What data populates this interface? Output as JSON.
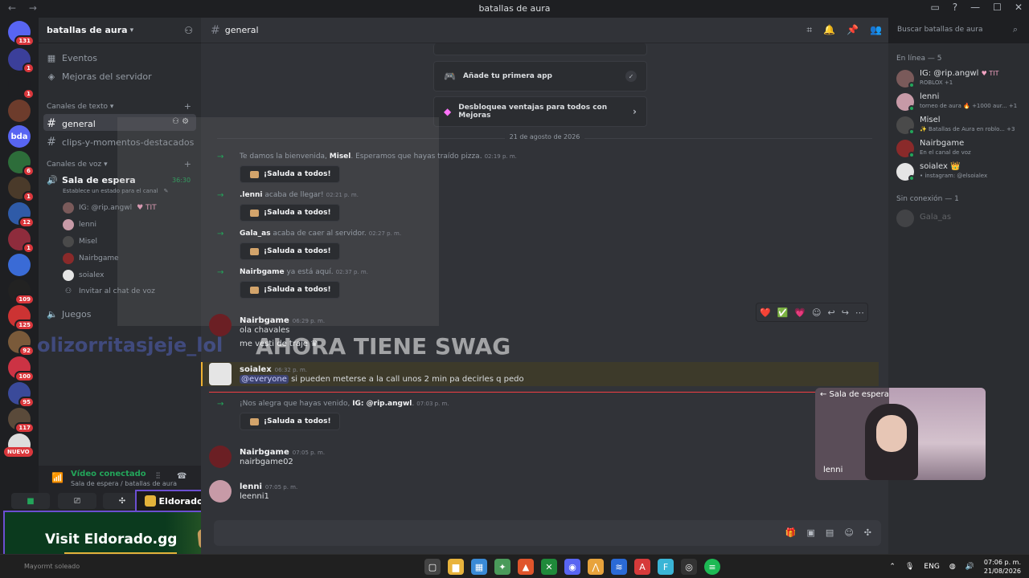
{
  "window": {
    "title": "batallas de aura",
    "nav": "← →",
    "controls": [
      "▭",
      "?",
      "—",
      "☐",
      "✕"
    ]
  },
  "rail": {
    "servers": [
      {
        "label": "",
        "badge": "131",
        "color": "#5865f2"
      },
      {
        "label": "",
        "badge": "1",
        "color": "#3b3f9a"
      },
      {
        "label": "",
        "badge": "1",
        "color": "#1e1f22"
      },
      {
        "label": "",
        "badge": "",
        "color": "#6d3c2c"
      },
      {
        "label": "bda",
        "badge": "",
        "color": "#5865f2"
      },
      {
        "label": "",
        "badge": "6",
        "color": "#2d6d3a"
      },
      {
        "label": "",
        "badge": "1",
        "color": "#4a3a2a"
      },
      {
        "label": "",
        "badge": "12",
        "color": "#2f5ba8"
      },
      {
        "label": "",
        "badge": "1",
        "color": "#8e2c3c"
      },
      {
        "label": "",
        "badge": "",
        "color": "#3a6bd6"
      },
      {
        "label": "",
        "badge": "109",
        "color": "#222"
      },
      {
        "label": "",
        "badge": "125",
        "color": "#c33"
      },
      {
        "label": "",
        "badge": "92",
        "color": "#7a5a3a"
      },
      {
        "label": "",
        "badge": "100",
        "color": "#c34"
      },
      {
        "label": "",
        "badge": "95",
        "color": "#3a4a9a"
      },
      {
        "label": "",
        "badge": "117",
        "color": "#5a4a3a"
      },
      {
        "label": "",
        "badge": "",
        "color": "#ddd"
      }
    ],
    "new_label": "NUEVO"
  },
  "sidebar": {
    "server_name": "batallas de aura",
    "items": [
      {
        "icon": "▦",
        "label": "Eventos"
      },
      {
        "icon": "◈",
        "label": "Mejoras del servidor"
      }
    ],
    "text_category": "Canales de texto",
    "text_channels": [
      "general",
      "clips-y-momentos-destacados"
    ],
    "voice_category": "Canales de voz",
    "voice_channel": {
      "name": "Sala de espera",
      "time": "36:30",
      "status": "Establece un estado para el canal"
    },
    "voice_users": [
      "IG: @rip.angwl",
      "lenni",
      "Misel",
      "Nairbgame",
      "soialex"
    ],
    "voice_user_tag": "♥ TIT",
    "invite_voice": "Invitar al chat de voz",
    "games": "Juegos"
  },
  "voice_connection": {
    "status": "Vídeo conectado",
    "location": "Sala de espera / batallas de aura"
  },
  "ad": {
    "tag": "Eldorado.gg",
    "text": "Visit Eldorado.gg"
  },
  "channel": {
    "name": "general",
    "search_placeholder": "Buscar batallas de aura"
  },
  "cards": [
    {
      "label": "Añade tu primera app"
    },
    {
      "label": "Desbloquea ventajas para todos con Mejoras"
    }
  ],
  "date_divider": "21 de agosto de 2026",
  "system_messages": [
    {
      "pre": "Te damos la bienvenida, ",
      "name": "Misel",
      "post": ". Esperamos que hayas traído pizza.",
      "time": "02:19 p. m."
    },
    {
      "pre": "",
      "name": ".lenni",
      "post": " acaba de llegar!",
      "time": "02:21 p. m."
    },
    {
      "pre": "",
      "name": "Gala_as",
      "post": " acaba de caer al servidor.",
      "time": "02:27 p. m."
    },
    {
      "pre": "",
      "name": "Nairbgame",
      "post": " ya está aquí.",
      "time": "02:37 p. m."
    },
    {
      "pre": "¡Nos alegra que hayas venido, ",
      "name": "IG: @rip.angwl",
      "post": ".",
      "time": "07:03 p. m."
    }
  ],
  "greet_label": "¡Saluda a todos!",
  "messages": [
    {
      "user": "Nairbgame",
      "time": "06:29 p. m.",
      "lines": [
        "ola chavales",
        "me vesti de traje"
      ]
    },
    {
      "user": "soialex",
      "time": "06:32 p. m.",
      "mention": "@everyone",
      "lines": [
        "si pueden meterse a la call unos 2 min pa decirles q pedo"
      ]
    },
    {
      "user": "Nairbgame",
      "time": "07:05 p. m.",
      "lines": [
        "nairbgame02"
      ]
    },
    {
      "user": "lenni",
      "time": "07:05 p. m.",
      "lines": [
        "leenni1"
      ]
    }
  ],
  "overlay_text": "AHORA TIENE SWAG",
  "overlay_text_left": "olizorritasjeje_lol",
  "reactions": [
    "❤️",
    "✅",
    "💗",
    "☺",
    "↩",
    "↪",
    "⋯"
  ],
  "members": {
    "online_label": "En línea — 5",
    "online": [
      {
        "name": "IG: @rip.angwl",
        "tag": "♥ TIT",
        "status": "ROBLOX +1",
        "color": "#7a5a5a"
      },
      {
        "name": "lenni",
        "tag": "",
        "status": "torneo de aura 🔥 +1000 aur... +1",
        "color": "#c79aa7"
      },
      {
        "name": "Misel",
        "tag": "",
        "status": "✨ Batallas de Aura en roblo... +3",
        "color": "#4a4a4a"
      },
      {
        "name": "Nairbgame",
        "tag": "",
        "status": "En el canal de voz",
        "color": "#8a2a2a"
      },
      {
        "name": "soialex",
        "tag": "👑",
        "status": "• instagram: @elsoialex",
        "color": "#e5e5e5"
      }
    ],
    "offline_label": "Sin conexión — 1",
    "offline": [
      {
        "name": "Gala_as",
        "color": "#777"
      }
    ]
  },
  "video": {
    "header": "← Sala de espera",
    "name": "lenni"
  },
  "taskbar": {
    "left_text": "Mayormt soleado",
    "lang": "ENG",
    "time": "07:06 p. m.",
    "date": "21/08/2026"
  }
}
